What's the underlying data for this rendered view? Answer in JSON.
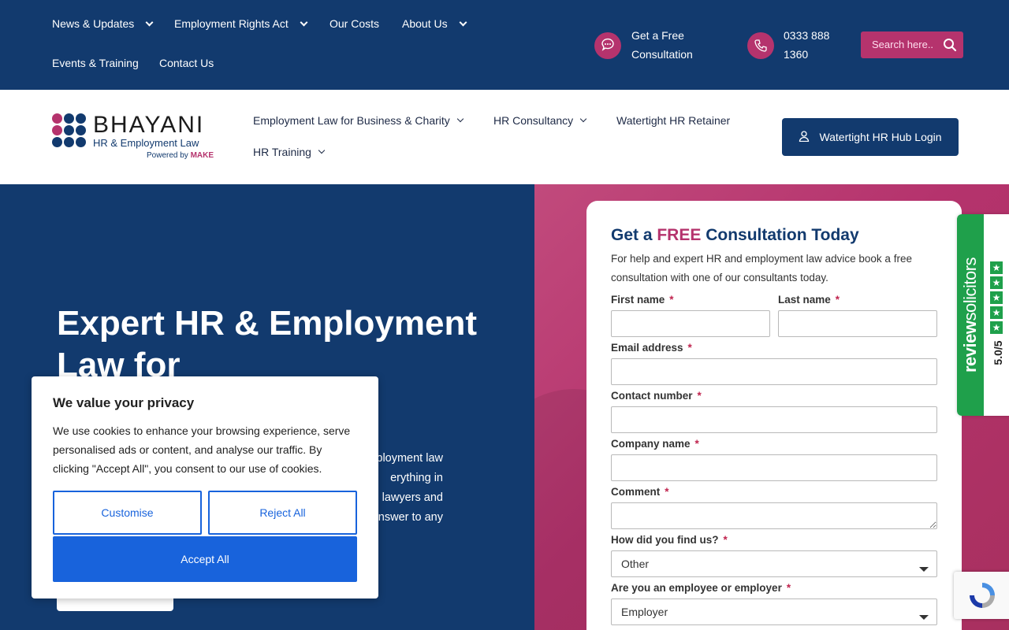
{
  "top_nav": {
    "items": [
      {
        "label": "News & Updates",
        "dropdown": true
      },
      {
        "label": "Employment Rights Act",
        "dropdown": true
      },
      {
        "label": "Our Costs",
        "dropdown": false
      },
      {
        "label": "About Us",
        "dropdown": true
      },
      {
        "label": "Events & Training",
        "dropdown": false
      },
      {
        "label": "Contact Us",
        "dropdown": false
      }
    ],
    "consultation_line1": "Get a Free",
    "consultation_line2": "Consultation",
    "phone_line1": "0333 888",
    "phone_line2": "1360",
    "search_placeholder": "Search here.."
  },
  "logo": {
    "name": "BHAYANI",
    "subtitle": "HR & Employment Law",
    "powered_prefix": "Powered by",
    "powered_brand": "MAKE"
  },
  "main_nav": {
    "items": [
      {
        "label": "Employment Law for Business & Charity",
        "dropdown": true
      },
      {
        "label": "HR Consultancy",
        "dropdown": true
      },
      {
        "label": "Watertight HR Retainer",
        "dropdown": false
      },
      {
        "label": "HR Training",
        "dropdown": true
      }
    ],
    "login_label": "Watertight HR Hub Login"
  },
  "hero": {
    "title": "Expert HR & Employment Law for",
    "desc_lines": [
      "ployment law",
      "erything in",
      "lawyers and",
      "nswer to any"
    ]
  },
  "form": {
    "title_prefix": "Get a ",
    "title_free": "FREE",
    "title_suffix": " Consultation Today",
    "intro": "For help and expert HR and employment law advice book a free consultation with one of our consultants today.",
    "required_mark": "*",
    "fields": {
      "first_name": "First name",
      "last_name": "Last name",
      "email": "Email address",
      "contact": "Contact number",
      "company": "Company name",
      "comment": "Comment",
      "find_us": "How did you find us?",
      "employee_employer": "Are you an employee or employer"
    },
    "find_us_value": "Other",
    "employee_employer_value": "Employer"
  },
  "review_badge": {
    "brand_prefix": "review",
    "brand_suffix": "solicitors",
    "rating": "5.0/5",
    "star_count": 5
  },
  "cookie": {
    "title": "We value your privacy",
    "text": "We use cookies to enhance your browsing experience, serve personalised ads or content, and analyse our traffic. By clicking \"Accept All\", you consent to our use of cookies.",
    "customise": "Customise",
    "reject": "Reject All",
    "accept": "Accept All"
  },
  "colors": {
    "navy": "#123a6e",
    "pink": "#b5336d",
    "cookie_blue": "#1863dc",
    "review_green": "#1fa04b"
  }
}
